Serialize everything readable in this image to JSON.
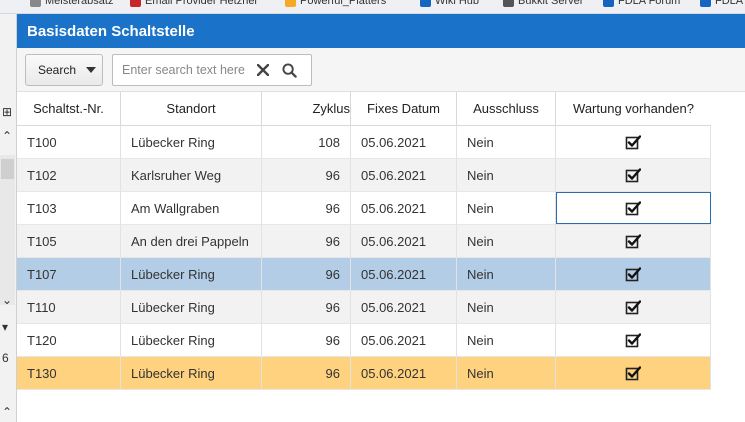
{
  "bookmarks": [
    {
      "label": "Meisterabsatz",
      "color": "#888888"
    },
    {
      "label": "Email Provider Hetzner",
      "color": "#c62828"
    },
    {
      "label": "Powerful_Platters",
      "color": "#f9a825"
    },
    {
      "label": "Wiki Hub",
      "color": "#1565c0"
    },
    {
      "label": "Bukkit Server",
      "color": "#555555"
    },
    {
      "label": "FDLA Forum",
      "color": "#1565c0"
    },
    {
      "label": "FDLA",
      "color": "#1565c0"
    }
  ],
  "gutter": {
    "digit": "6"
  },
  "panel": {
    "title": "Basisdaten Schaltstelle"
  },
  "toolbar": {
    "search_dropdown_label": "Search",
    "search_placeholder": "Enter search text here"
  },
  "table": {
    "columns": [
      "Schaltst.-Nr.",
      "Standort",
      "Zyklus",
      "Fixes Datum",
      "Ausschluss",
      "Wartung vorhanden?"
    ],
    "rows": [
      {
        "nr": "T100",
        "standort": "Lübecker Ring",
        "zyklus": "108",
        "datum": "05.06.2021",
        "ausschluss": "Nein",
        "wartung": true,
        "state": "normal"
      },
      {
        "nr": "T102",
        "standort": "Karlsruher Weg",
        "zyklus": "96",
        "datum": "05.06.2021",
        "ausschluss": "Nein",
        "wartung": true,
        "state": "alt"
      },
      {
        "nr": "T103",
        "standort": "Am Wallgraben",
        "zyklus": "96",
        "datum": "05.06.2021",
        "ausschluss": "Nein",
        "wartung": true,
        "state": "focus"
      },
      {
        "nr": "T105",
        "standort": "An den drei Pappeln",
        "zyklus": "96",
        "datum": "05.06.2021",
        "ausschluss": "Nein",
        "wartung": true,
        "state": "alt"
      },
      {
        "nr": "T107",
        "standort": "Lübecker Ring",
        "zyklus": "96",
        "datum": "05.06.2021",
        "ausschluss": "Nein",
        "wartung": true,
        "state": "selected"
      },
      {
        "nr": "T110",
        "standort": "Lübecker Ring",
        "zyklus": "96",
        "datum": "05.06.2021",
        "ausschluss": "Nein",
        "wartung": true,
        "state": "alt"
      },
      {
        "nr": "T120",
        "standort": "Lübecker Ring",
        "zyklus": "96",
        "datum": "05.06.2021",
        "ausschluss": "Nein",
        "wartung": true,
        "state": "normal"
      },
      {
        "nr": "T130",
        "standort": "Lübecker Ring",
        "zyklus": "96",
        "datum": "05.06.2021",
        "ausschluss": "Nein",
        "wartung": true,
        "state": "highlight"
      }
    ]
  },
  "colors": {
    "header_blue": "#1a73c9",
    "row_alt": "#f2f2f2",
    "row_selected": "#b3cde6",
    "row_highlight": "#ffd27f"
  }
}
